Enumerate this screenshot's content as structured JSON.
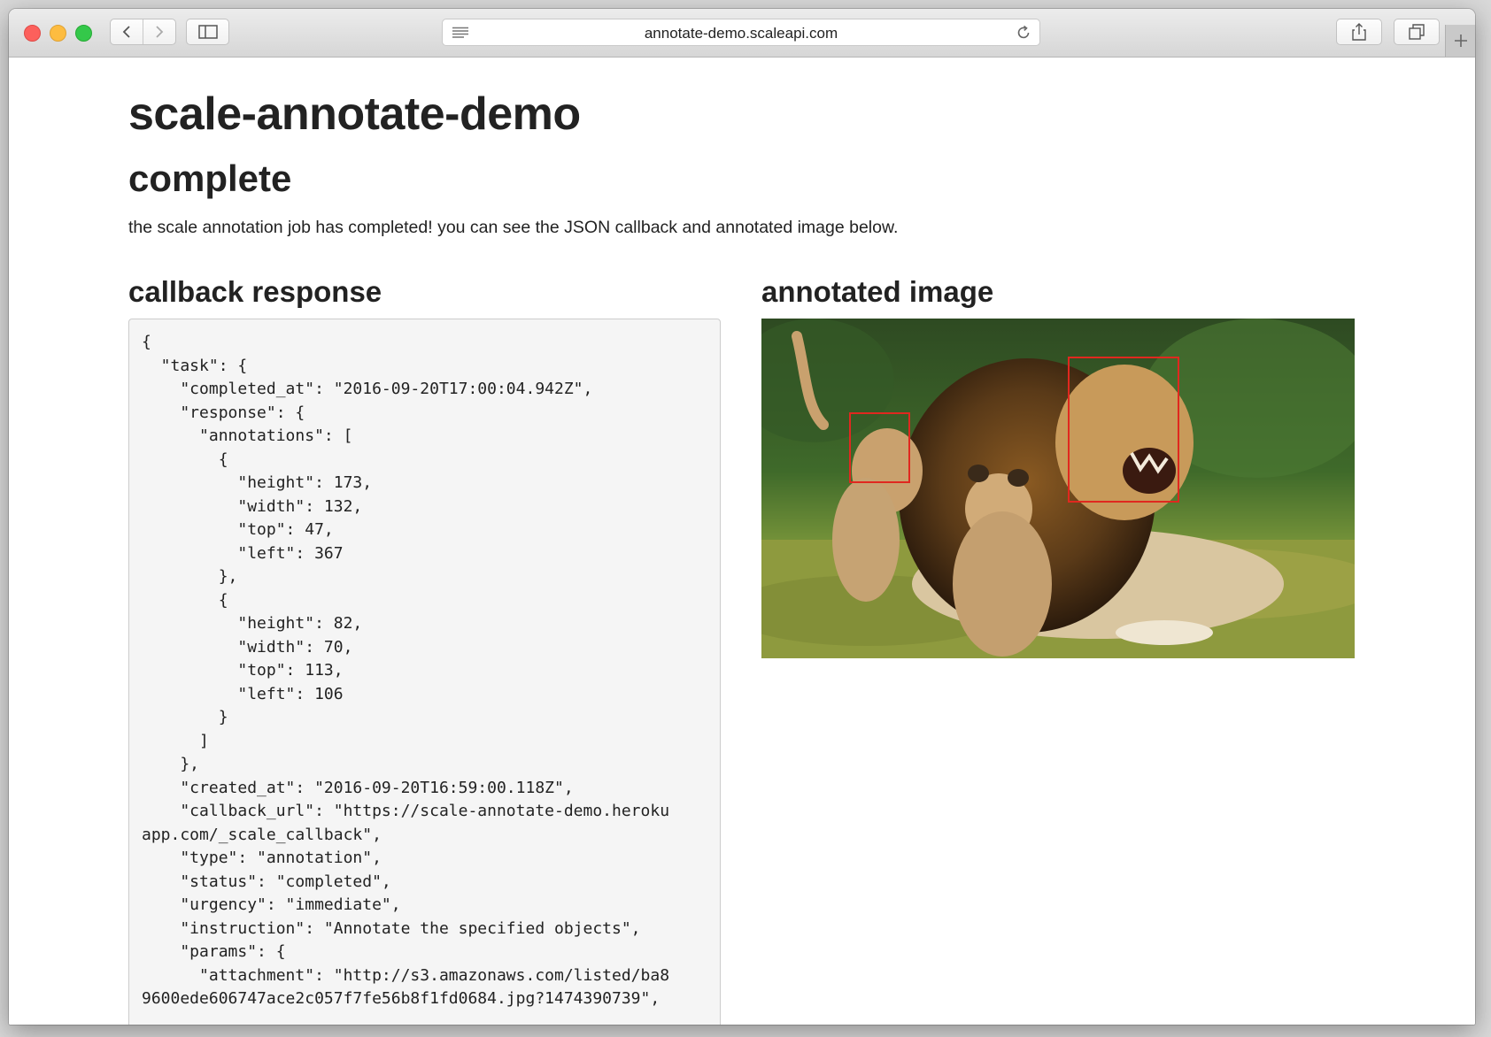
{
  "browser": {
    "url": "annotate-demo.scaleapi.com"
  },
  "page": {
    "title": "scale-annotate-demo",
    "status_heading": "complete",
    "status_message": "the scale annotation job has completed! you can see the JSON callback and annotated image below.",
    "callback_heading": "callback response",
    "image_heading": "annotated image",
    "callback_json": "{\n  \"task\": {\n    \"completed_at\": \"2016-09-20T17:00:04.942Z\",\n    \"response\": {\n      \"annotations\": [\n        {\n          \"height\": 173,\n          \"width\": 132,\n          \"top\": 47,\n          \"left\": 367\n        },\n        {\n          \"height\": 82,\n          \"width\": 70,\n          \"top\": 113,\n          \"left\": 106\n        }\n      ]\n    },\n    \"created_at\": \"2016-09-20T16:59:00.118Z\",\n    \"callback_url\": \"https://scale-annotate-demo.heroku\napp.com/_scale_callback\",\n    \"type\": \"annotation\",\n    \"status\": \"completed\",\n    \"urgency\": \"immediate\",\n    \"instruction\": \"Annotate the specified objects\",\n    \"params\": {\n      \"attachment\": \"http://s3.amazonaws.com/listed/ba8\n9600ede606747ace2c057f7fe56b8f1fd0684.jpg?1474390739\","
  },
  "colors": {
    "bbox": "#e0281f",
    "json_bg": "#f5f5f5"
  }
}
